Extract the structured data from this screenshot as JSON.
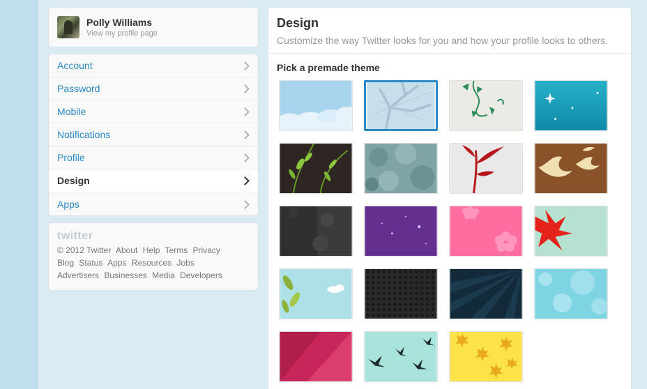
{
  "profile": {
    "name": "Polly Williams",
    "subtitle": "View my profile page"
  },
  "nav": {
    "items": [
      {
        "label": "Account",
        "active": false
      },
      {
        "label": "Password",
        "active": false
      },
      {
        "label": "Mobile",
        "active": false
      },
      {
        "label": "Notifications",
        "active": false
      },
      {
        "label": "Profile",
        "active": false
      },
      {
        "label": "Design",
        "active": true
      },
      {
        "label": "Apps",
        "active": false
      }
    ]
  },
  "footer": {
    "logo": "twitter",
    "line1": [
      "© 2012 Twitter",
      "About",
      "Help",
      "Terms",
      "Privacy"
    ],
    "line2": [
      "Blog",
      "Status",
      "Apps",
      "Resources",
      "Jobs"
    ],
    "line3": [
      "Advertisers",
      "Businesses",
      "Media",
      "Developers"
    ]
  },
  "main": {
    "title": "Design",
    "subtitle": "Customize the way Twitter looks for you and how your profile looks to others.",
    "section_label": "Pick a premade theme",
    "themes": [
      {
        "name": "theme-clouds",
        "selected": false
      },
      {
        "name": "theme-branches",
        "selected": true
      },
      {
        "name": "theme-vines",
        "selected": false
      },
      {
        "name": "theme-sparkles",
        "selected": false
      },
      {
        "name": "theme-leaves-dark",
        "selected": false
      },
      {
        "name": "theme-foliage",
        "selected": false
      },
      {
        "name": "theme-red-plant",
        "selected": false
      },
      {
        "name": "theme-birds-brown",
        "selected": false
      },
      {
        "name": "theme-grunge-dark",
        "selected": false
      },
      {
        "name": "theme-purple-stars",
        "selected": false
      },
      {
        "name": "theme-pink-flowers",
        "selected": false
      },
      {
        "name": "theme-red-leaf",
        "selected": false
      },
      {
        "name": "theme-green-leaves-sky",
        "selected": false
      },
      {
        "name": "theme-hex-dark",
        "selected": false
      },
      {
        "name": "theme-navy-rays",
        "selected": false
      },
      {
        "name": "theme-bokeh-cyan",
        "selected": false
      },
      {
        "name": "theme-crimson-diagonal",
        "selected": false
      },
      {
        "name": "theme-birds-mint",
        "selected": false
      },
      {
        "name": "theme-yellow-leaves",
        "selected": false
      }
    ]
  },
  "colors": {
    "link": "#2a8ac7",
    "background": "#c0deed",
    "selected_border": "#2a8ac7"
  }
}
